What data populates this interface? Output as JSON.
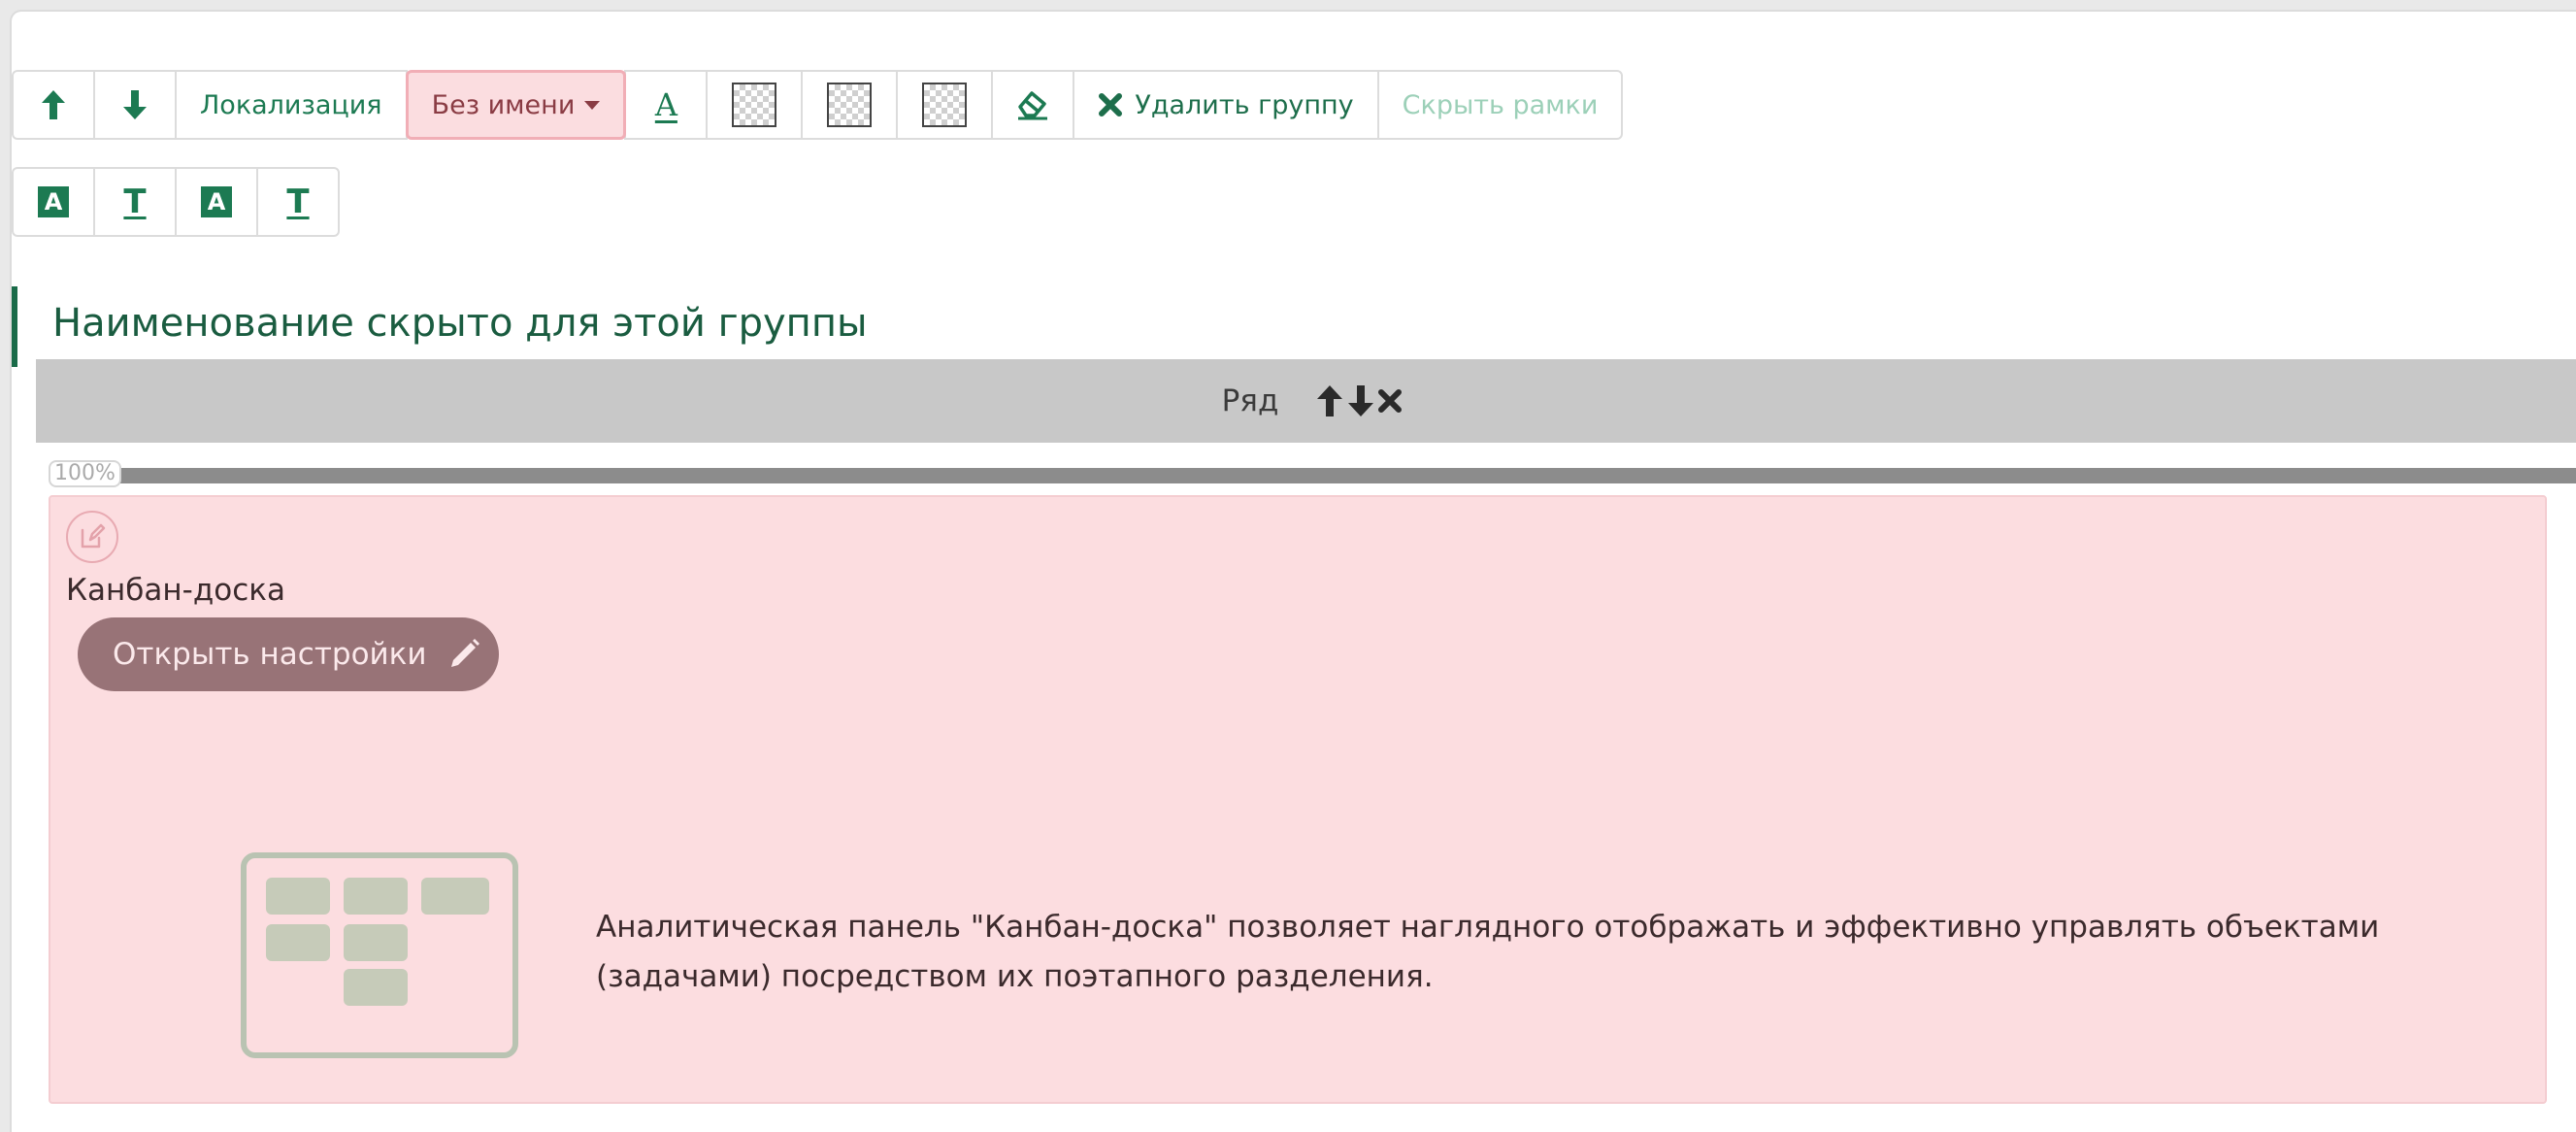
{
  "toolbar": {
    "move_up_icon": "arrow-up-icon",
    "move_down_icon": "arrow-down-icon",
    "localization_label": "Локализация",
    "name_dropdown_label": "Без имени",
    "delete_group_label": "Удалить группу",
    "hide_frames_label": "Скрыть рамки"
  },
  "group": {
    "title": "Наименование скрыто для этой группы",
    "row_label": "Ряд",
    "width_percent": "100%"
  },
  "widget": {
    "name": "Канбан-доска",
    "open_settings_label": "Открыть настройки",
    "description": "Аналитическая панель \"Канбан-доска\" позволяет наглядного отображать и эффективно управлять объектами (задачами) посредством их поэтапного разделения."
  },
  "colors": {
    "accent": "#1c7a52",
    "widget_background": "#fcdde0",
    "open_button": "#987377",
    "row_bar": "#c8c8c8"
  }
}
